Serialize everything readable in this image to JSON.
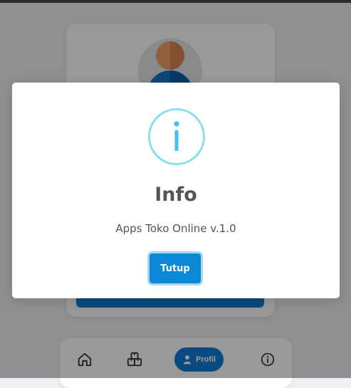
{
  "dialog": {
    "title": "Info",
    "message": "Apps Toko Online v.1.0",
    "close_label": "Tutup",
    "icon": "info-circle-icon",
    "icon_color": "#3fc3ee",
    "button_color": "#0b88d6"
  },
  "nav": {
    "items": [
      {
        "id": "home",
        "icon": "home-icon"
      },
      {
        "id": "products",
        "icon": "boxes-icon"
      },
      {
        "id": "profile",
        "icon": "user-icon",
        "label": "Profil",
        "active": true
      },
      {
        "id": "info",
        "icon": "info-icon"
      }
    ]
  },
  "colors": {
    "accent": "#0f7cd8",
    "backdrop": "#eef0f3"
  }
}
